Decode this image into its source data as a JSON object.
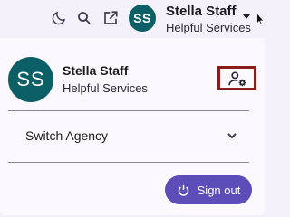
{
  "topbar": {
    "moon_icon": "dark-mode-moon-icon",
    "search_icon": "search-icon",
    "launch_icon": "open-in-new-icon",
    "avatar_initials": "SS",
    "user_name": "Stella Staff",
    "org_name": "Helpful Services"
  },
  "panel": {
    "avatar_initials": "SS",
    "user_name": "Stella Staff",
    "org_name": "Helpful Services",
    "manage_icon": "manage-account-icon",
    "switch_agency_label": "Switch Agency",
    "sign_out_label": "Sign out"
  },
  "colors": {
    "avatar_bg": "#0d5f66",
    "sign_out_bg": "#5c4db8",
    "highlight_border": "#8b1c1c",
    "panel_bg": "#fbf8fe",
    "page_bg": "#f4f1fa"
  }
}
